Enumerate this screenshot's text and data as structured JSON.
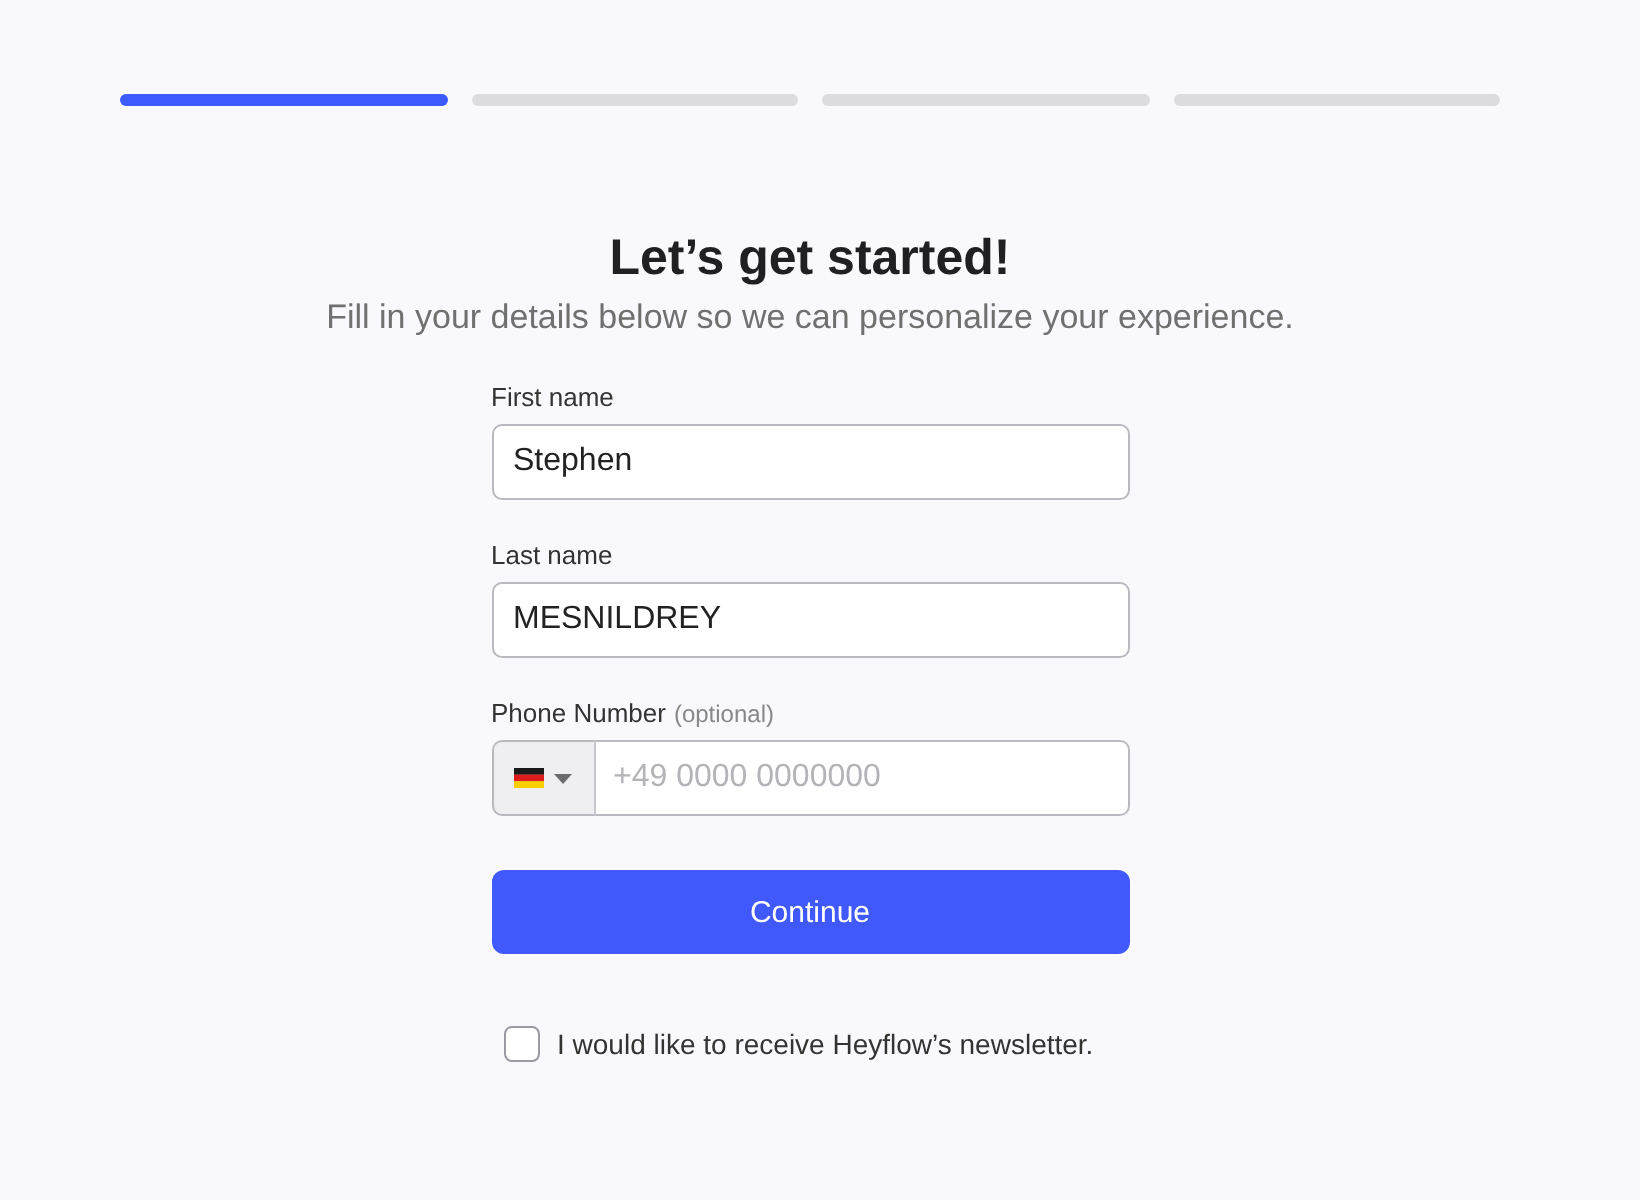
{
  "progress": {
    "steps": [
      {
        "active": true
      },
      {
        "active": false
      },
      {
        "active": false
      },
      {
        "active": false
      }
    ]
  },
  "heading": {
    "title": "Let’s get started!",
    "subtitle": "Fill in your details below so we can personalize your experience."
  },
  "form": {
    "fields": [
      {
        "kind": "text",
        "label": "First name",
        "value": "Stephen"
      },
      {
        "kind": "text",
        "label": "Last name",
        "value": "MESNILDREY"
      },
      {
        "kind": "phone",
        "label": "Phone Number",
        "hint": "(optional)",
        "placeholder": "+49 0000 0000000"
      }
    ],
    "submit": "Continue",
    "newsletter": {
      "label": "I would like to receive Heyflow’s newsletter.",
      "checked": false
    }
  }
}
